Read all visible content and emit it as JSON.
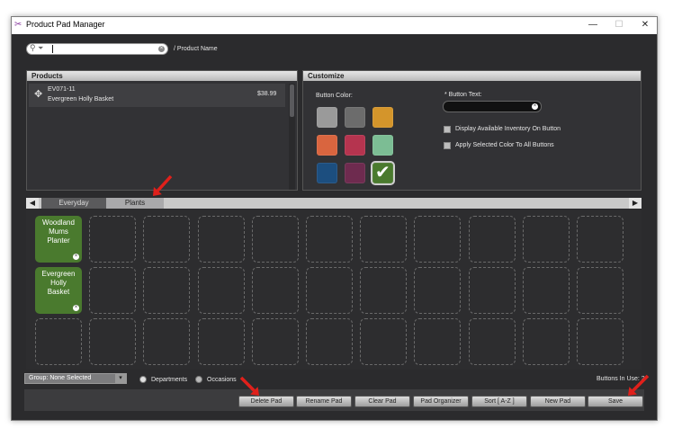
{
  "window": {
    "title": "Product Pad Manager",
    "minimize": "—",
    "maximize": "☐",
    "close": "✕"
  },
  "search": {
    "value": "",
    "path_label": "/ Product Name"
  },
  "products": {
    "header": "Products",
    "items": [
      {
        "sku": "EV071-11",
        "name": "Evergreen Holly Basket",
        "price": "$38.99"
      }
    ]
  },
  "customize": {
    "header": "Customize",
    "button_color_label": "Button Color:",
    "button_text_label": "* Button Text:",
    "button_text_value": "",
    "options": [
      {
        "label": "Display Available Inventory On Button"
      },
      {
        "label": "Apply Selected Color To All Buttons"
      }
    ],
    "colors": [
      "#9a9a9a",
      "#6c6c6c",
      "#d4952b",
      "#d9653f",
      "#b5344f",
      "#7cbd94",
      "#1c4e7f",
      "#6e2b4f",
      "#4a7a2e"
    ],
    "selected_color_index": 8,
    "check_icon": "✔"
  },
  "tabs": {
    "items": [
      {
        "label": "Everyday"
      },
      {
        "label": "Plants"
      }
    ],
    "active_index": 1
  },
  "pads": [
    {
      "label": "Woodland Mums Planter"
    },
    {
      "label": "Evergreen Holly Basket"
    }
  ],
  "footer": {
    "group_select": "Group: None Selected",
    "radio_departments": "Departments",
    "radio_occasions": "Occasions",
    "buttons_in_use": "Buttons In Use: 2"
  },
  "buttons": {
    "delete_pad": "Delete Pad",
    "rename_pad": "Rename Pad",
    "clear_pad": "Clear Pad",
    "pad_organizer": "Pad Organizer",
    "sort": "Sort [ A-Z ]",
    "new_pad": "New Pad",
    "save": "Save"
  },
  "annotation_color": "#e0201b"
}
